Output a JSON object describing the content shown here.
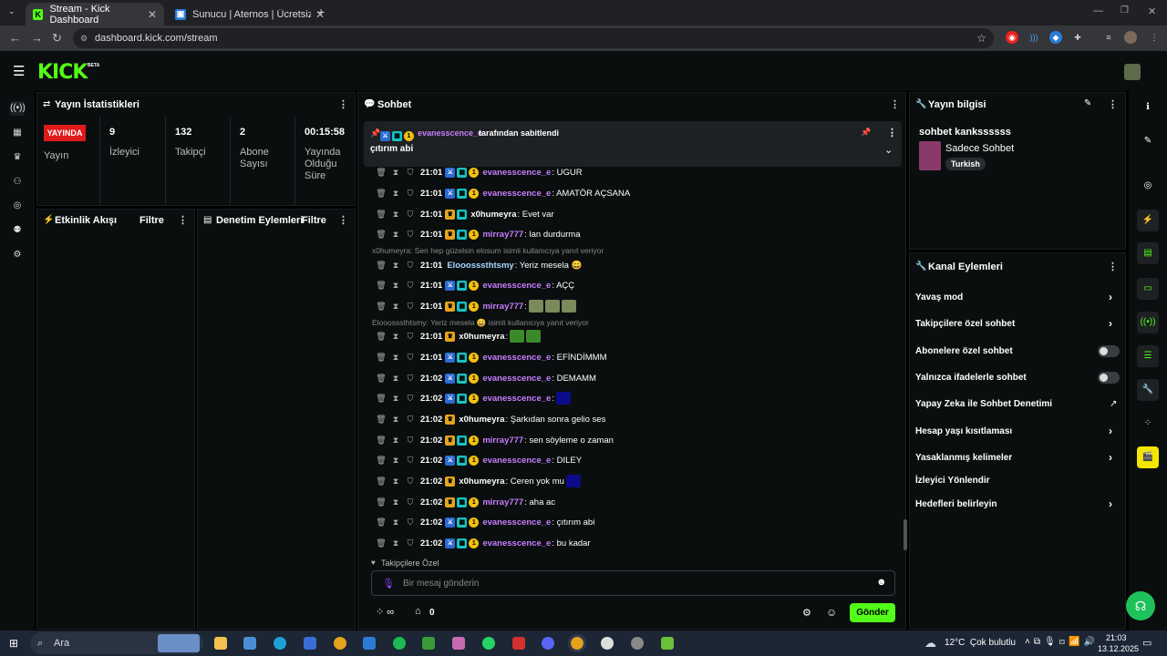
{
  "browser": {
    "tabs": [
      {
        "title": "Stream - Kick Dashboard",
        "active": true
      },
      {
        "title": "Sunucu | Aternos | Ücretsiz Min",
        "active": false
      }
    ],
    "url": "dashboard.kick.com/stream"
  },
  "kick": {
    "logo": "KICK",
    "beta": "BETA"
  },
  "stats": {
    "title": "Yayın İstatistikleri",
    "live_badge": "YAYINDA",
    "live_label": "Yayın",
    "viewers": {
      "value": "9",
      "label": "İzleyici"
    },
    "followers": {
      "value": "132",
      "label": "Takipçi"
    },
    "subs": {
      "value": "2",
      "label": "Abone Sayısı"
    },
    "duration": {
      "value": "00:15:58",
      "label": "Yayında Olduğu Süre"
    }
  },
  "activity": {
    "title": "Etkinlik Akışı",
    "filter": "Filtre"
  },
  "moderation": {
    "title": "Denetim Eylemleri",
    "filter": "Filtre"
  },
  "chat": {
    "title": "Sohbet",
    "pinned": {
      "by_user": "evanesscence_e",
      "by_text": "tarafından sabitlendi",
      "text": "çıtırım abi"
    },
    "messages": [
      {
        "time": "21:01",
        "user": "evanesscence_e",
        "color": "#c77dff",
        "text": ": UGUR",
        "badges": [
          "sub",
          "gift",
          "one"
        ]
      },
      {
        "time": "21:01",
        "user": "evanesscence_e",
        "color": "#c77dff",
        "text": ": AMATÖR AÇSANA",
        "badges": [
          "sub",
          "gift",
          "one"
        ]
      },
      {
        "time": "21:01",
        "user": "x0humeyra",
        "color": "#ffffff",
        "text": ": Evet var",
        "badges": [
          "crown",
          "gift"
        ]
      },
      {
        "time": "21:01",
        "user": "mirray777",
        "color": "#c77dff",
        "text": ": lan durdurma",
        "badges": [
          "crown",
          "gift",
          "one"
        ]
      },
      {
        "time": "21:01",
        "user": "Elooosssthtsmy",
        "color": "#a8d8ff",
        "text": ": Yeriz mesela 😄",
        "badges": []
      },
      {
        "time": "21:01",
        "user": "evanesscence_e",
        "color": "#c77dff",
        "text": ": AÇÇ",
        "badges": [
          "sub",
          "gift",
          "one"
        ]
      },
      {
        "time": "21:01",
        "user": "mirray777",
        "color": "#c77dff",
        "text": ":",
        "badges": [
          "crown",
          "gift",
          "one"
        ]
      },
      {
        "time": "21:01",
        "user": "x0humeyra",
        "color": "#ffffff",
        "text": ":",
        "badges": [
          "crown"
        ]
      },
      {
        "time": "21:01",
        "user": "evanesscence_e",
        "color": "#c77dff",
        "text": ": EFİNDİMMM",
        "badges": [
          "sub",
          "gift",
          "one"
        ]
      },
      {
        "time": "21:02",
        "user": "evanesscence_e",
        "color": "#c77dff",
        "text": ": DEMAMM",
        "badges": [
          "sub",
          "gift",
          "one"
        ]
      },
      {
        "time": "21:02",
        "user": "evanesscence_e",
        "color": "#c77dff",
        "text": ":",
        "badges": [
          "sub",
          "gift",
          "one"
        ]
      },
      {
        "time": "21:02",
        "user": "x0humeyra",
        "color": "#ffffff",
        "text": ": Şarkıdan sonra gelio ses",
        "badges": [
          "crown"
        ]
      },
      {
        "time": "21:02",
        "user": "mirray777",
        "color": "#c77dff",
        "text": ": sen söyleme o zaman",
        "badges": [
          "crown",
          "gift",
          "one"
        ]
      },
      {
        "time": "21:02",
        "user": "evanesscence_e",
        "color": "#c77dff",
        "text": ": DILEY",
        "badges": [
          "sub",
          "gift",
          "one"
        ]
      },
      {
        "time": "21:02",
        "user": "x0humeyra",
        "color": "#ffffff",
        "text": ": Ceren yok mu",
        "badges": [
          "crown"
        ]
      },
      {
        "time": "21:02",
        "user": "mirray777",
        "color": "#c77dff",
        "text": ": aha ac",
        "badges": [
          "crown",
          "gift",
          "one"
        ]
      },
      {
        "time": "21:02",
        "user": "evanesscence_e",
        "color": "#c77dff",
        "text": ": çıtırım abi",
        "badges": [
          "sub",
          "gift",
          "one"
        ]
      },
      {
        "time": "21:02",
        "user": "evanesscence_e",
        "color": "#c77dff",
        "text": ": bu kadar",
        "badges": [
          "sub",
          "gift",
          "one"
        ]
      }
    ],
    "replies": [
      "x0humeyra: Sen hep güzelsin elosum isimli kullanıcıya yanıt veriyor",
      "Elooosssthtsmy: Yeriz mesela 😄 isimli kullanıcıya yanıt veriyor"
    ],
    "followers_only": "Takipçilere Özel",
    "input_placeholder": "Bir mesaj gönderin",
    "points": "0",
    "send": "Gönder"
  },
  "stream_info": {
    "title": "Yayın bilgisi",
    "stream_title": "sohbet kankssssss",
    "category": "Sadece Sohbet",
    "tag": "Turkish"
  },
  "channel_actions": {
    "title": "Kanal Eylemleri",
    "items": [
      "Yavaş mod",
      "Takipçilere özel sohbet",
      "Abonelere özel sohbet",
      "Yalnızca ifadelerle sohbet",
      "Yapay Zeka ile Sohbet Denetimi",
      "Hesap yaşı kısıtlaması",
      "Yasaklanmış kelimeler",
      "İzleyici Yönlendir",
      "Hedefleri belirleyin"
    ]
  },
  "taskbar": {
    "search": "Ara",
    "weather": "12°C  Çok bulutlu",
    "time": "21:03",
    "date": "13.12.2025"
  },
  "colors": {
    "accent": "#53fc18",
    "live": "#e01a1a"
  }
}
